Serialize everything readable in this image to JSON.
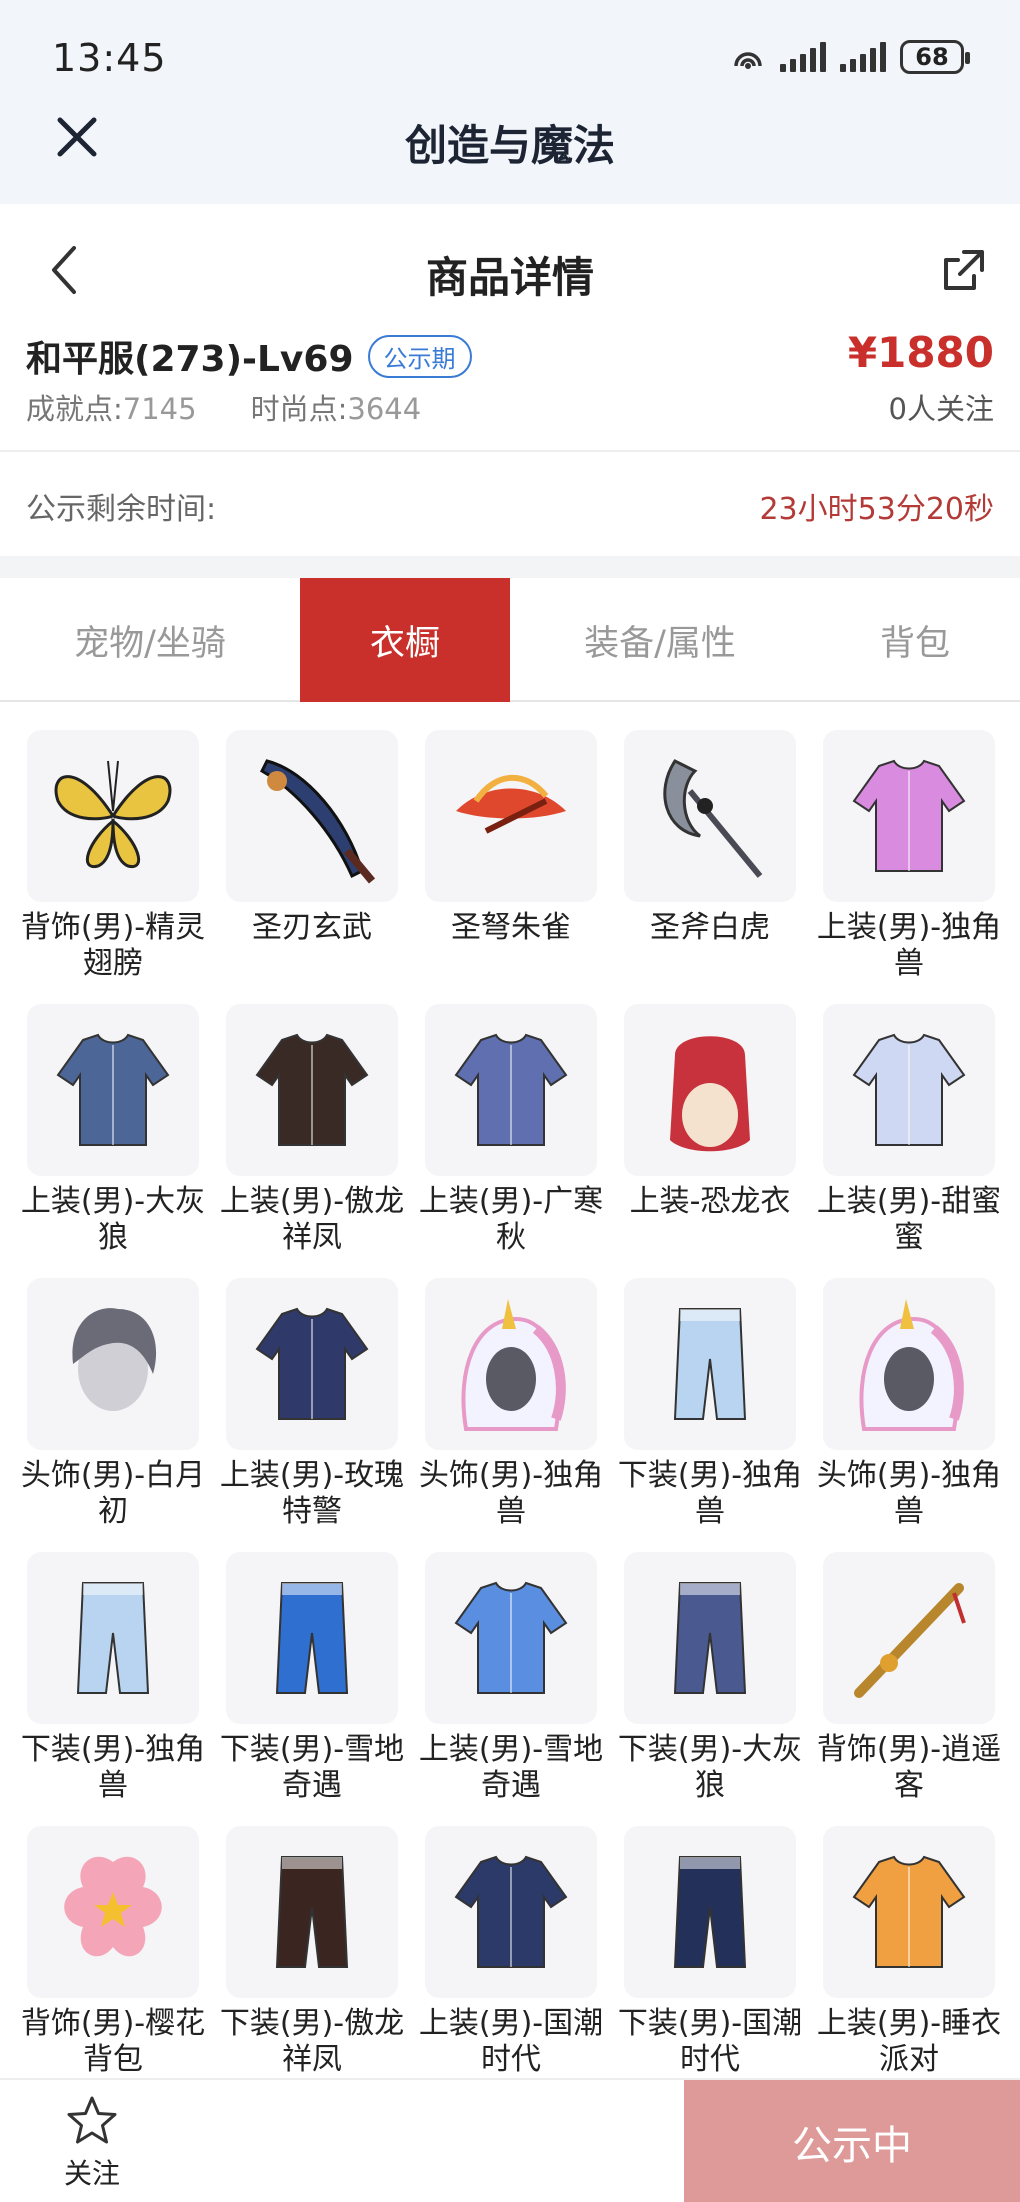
{
  "status_bar": {
    "time": "13:45",
    "battery": "68"
  },
  "app_bar": {
    "title": "创造与魔法"
  },
  "page": {
    "title": "商品详情"
  },
  "product": {
    "name": "和平服(273)-Lv69",
    "badge": "公示期",
    "price": "¥1880",
    "achievement_label": "成就点:",
    "achievement_value": "7145",
    "fashion_label": "时尚点:",
    "fashion_value": "3644",
    "follow_count": "0人关注"
  },
  "remaining": {
    "label": "公示剩余时间:",
    "value": "23小时53分20秒"
  },
  "tabs": [
    {
      "label": "宠物/坐骑",
      "active": false
    },
    {
      "label": "衣橱",
      "active": true
    },
    {
      "label": "装备/属性",
      "active": false
    },
    {
      "label": "背包",
      "active": false
    }
  ],
  "items": [
    {
      "label": "背饰(男)-精灵翅膀",
      "icon": "butterfly-wings-icon",
      "color": "#e8c440"
    },
    {
      "label": "圣刃玄武",
      "icon": "blade-icon",
      "color": "#2c3f70"
    },
    {
      "label": "圣弩朱雀",
      "icon": "crossbow-icon",
      "color": "#e0482e"
    },
    {
      "label": "圣斧白虎",
      "icon": "axe-icon",
      "color": "#8a8f9c"
    },
    {
      "label": "上装(男)-独角兽",
      "icon": "rainbow-wings-outfit-icon",
      "color": "#d98be0"
    },
    {
      "label": "上装(男)-大灰狼",
      "icon": "apron-outfit-icon",
      "color": "#4d6698"
    },
    {
      "label": "上装(男)-傲龙祥凤",
      "icon": "dragon-robe-icon",
      "color": "#3a2a25"
    },
    {
      "label": "上装(男)-广寒秋",
      "icon": "fur-robe-icon",
      "color": "#5f6fb0"
    },
    {
      "label": "上装-恐龙衣",
      "icon": "dino-suit-icon",
      "color": "#c8323c"
    },
    {
      "label": "上装(男)-甜蜜蜜",
      "icon": "sweet-jacket-icon",
      "color": "#cfd8f2"
    },
    {
      "label": "头饰(男)-白月初",
      "icon": "hair-icon",
      "color": "#6b6b78"
    },
    {
      "label": "上装(男)-玫瑰特警",
      "icon": "uniform-icon",
      "color": "#2f3a6b"
    },
    {
      "label": "头饰(男)-独角兽",
      "icon": "unicorn-hood-icon",
      "color": "#e79ac8"
    },
    {
      "label": "下装(男)-独角兽",
      "icon": "unicorn-boots-icon",
      "color": "#b8d4f0"
    },
    {
      "label": "头饰(男)-独角兽",
      "icon": "unicorn-hood-icon",
      "color": "#e79ac8"
    },
    {
      "label": "下装(男)-独角兽",
      "icon": "unicorn-boots-icon",
      "color": "#b8d4f0"
    },
    {
      "label": "下装(男)-雪地奇遇",
      "icon": "snow-pants-icon",
      "color": "#2f6fd0"
    },
    {
      "label": "上装(男)-雪地奇遇",
      "icon": "snow-jacket-icon",
      "color": "#5a8ee0"
    },
    {
      "label": "下装(男)-大灰狼",
      "icon": "grey-pants-icon",
      "color": "#4a5a90"
    },
    {
      "label": "背饰(男)-逍遥客",
      "icon": "flute-icon",
      "color": "#b8862c"
    },
    {
      "label": "背饰(男)-樱花背包",
      "icon": "sakura-bag-icon",
      "color": "#f4a6b8"
    },
    {
      "label": "下装(男)-傲龙祥凤",
      "icon": "dark-pants-icon",
      "color": "#3a2520"
    },
    {
      "label": "上装(男)-国潮时代",
      "icon": "kimono-icon",
      "color": "#2c3a6a"
    },
    {
      "label": "下装(男)-国潮时代",
      "icon": "navy-pants-icon",
      "color": "#23305a"
    },
    {
      "label": "上装(男)-睡衣派对",
      "icon": "pajama-icon",
      "color": "#f0a040"
    }
  ],
  "bottom_bar": {
    "follow_label": "关注",
    "status_button": "公示中"
  },
  "colors": {
    "accent": "#c9302c",
    "price": "#c9302c",
    "link": "#3a7bd5",
    "disabled_button": "#de9a98"
  }
}
